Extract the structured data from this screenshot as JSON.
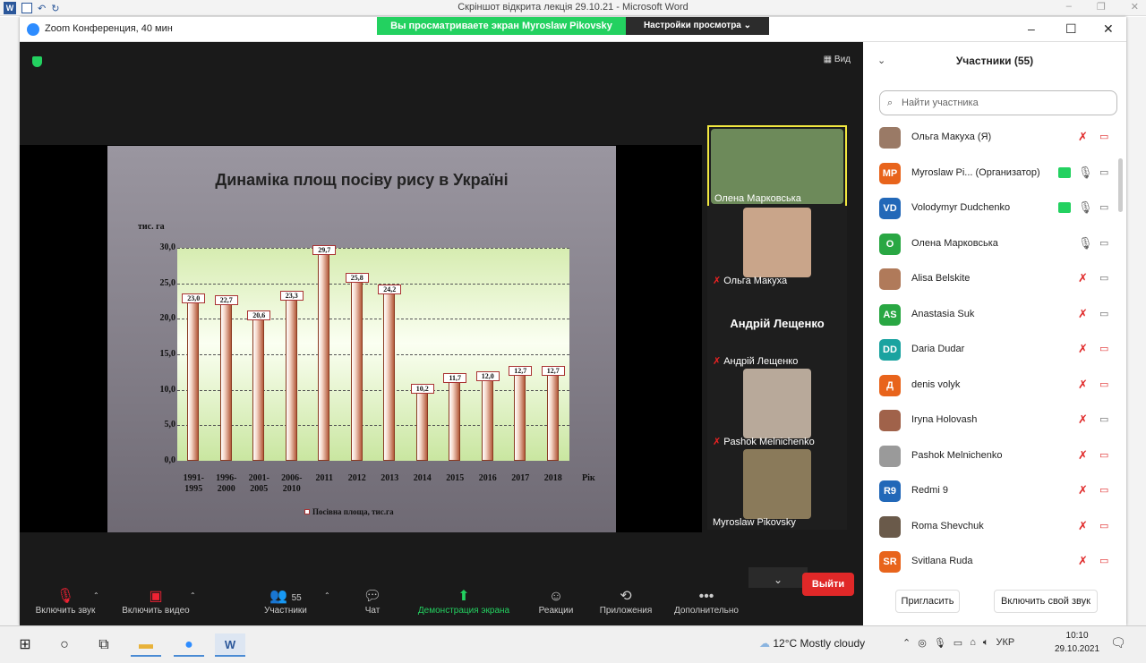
{
  "word": {
    "title": "Скріншот відкрита лекція 29.10.21 - Microsoft Word"
  },
  "zoom": {
    "title": "Zoom Конференция, 40 мин",
    "share_banner": "Вы просматриваете экран Myroslaw Pikovsky",
    "view_settings": "Настройки просмотра ⌄",
    "view_button": "Вид"
  },
  "slide": {
    "title": "Динаміка площ посіву рису в Україні",
    "legend": "Посівна площа, тис.га"
  },
  "chart_data": {
    "type": "bar",
    "title": "Динаміка площ посіву рису в Україні",
    "ylabel": "тис. га",
    "xlabel": "Рік",
    "ylim": [
      0,
      30
    ],
    "yticks": [
      "0,0",
      "5,0",
      "10,0",
      "15,0",
      "20,0",
      "25,0",
      "30,0"
    ],
    "categories": [
      "1991-1995",
      "1996-2000",
      "2001-2005",
      "2006-2010",
      "2011",
      "2012",
      "2013",
      "2014",
      "2015",
      "2016",
      "2017",
      "2018"
    ],
    "category_lines": [
      [
        "1991-",
        "1995"
      ],
      [
        "1996-",
        "2000"
      ],
      [
        "2001-",
        "2005"
      ],
      [
        "2006-",
        "2010"
      ],
      [
        "2011"
      ],
      [
        "2012"
      ],
      [
        "2013"
      ],
      [
        "2014"
      ],
      [
        "2015"
      ],
      [
        "2016"
      ],
      [
        "2017"
      ],
      [
        "2018"
      ]
    ],
    "values": [
      23.0,
      22.7,
      20.6,
      23.3,
      29.7,
      25.8,
      24.2,
      10.2,
      11.7,
      12.0,
      12.7,
      12.7
    ],
    "value_labels": [
      "23,0",
      "22,7",
      "20,6",
      "23,3",
      "29,7",
      "25,8",
      "24,2",
      "10,2",
      "11,7",
      "12,0",
      "12,7",
      "12,7"
    ],
    "series": [
      {
        "name": "Посівна площа, тис.га"
      }
    ],
    "grid": true,
    "legend": "bottom"
  },
  "thumbnails": [
    {
      "name": "Олена Марковська",
      "muted": false,
      "active": true,
      "bg": "#6d8a5a"
    },
    {
      "name": "Ольга Макуха",
      "muted": true,
      "active": false,
      "bg": "#c9a58a"
    },
    {
      "name": "Андрій Лещенко",
      "muted": true,
      "active": false,
      "big": "Андрій Лещенко"
    },
    {
      "name": "Pashok Melnichenko",
      "muted": true,
      "active": false,
      "bg": "#b8a99a"
    },
    {
      "name": "Myroslaw Pikovsky",
      "muted": false,
      "active": false,
      "bg": "#8a7a5a"
    }
  ],
  "toolbar": {
    "audio": "Включить звук",
    "video": "Включить видео",
    "participants": "Участники",
    "participants_count": "55",
    "chat": "Чат",
    "share": "Демонстрация экрана",
    "reactions": "Реакции",
    "apps": "Приложения",
    "more": "Дополнительно",
    "leave": "Выйти"
  },
  "panel": {
    "title": "Участники (55)",
    "search_placeholder": "Найти участника",
    "invite": "Пригласить",
    "unmute_self": "Включить свой звук",
    "participants": [
      {
        "name": "Ольга Макуха (Я)",
        "initials": "",
        "color": "#9a7a66",
        "mic_muted": true,
        "cam_off": true,
        "sharing": false
      },
      {
        "name": "Myroslaw Pi... (Организатор)",
        "initials": "MP",
        "color": "#e8641c",
        "mic_muted": false,
        "cam_off": false,
        "sharing": true
      },
      {
        "name": "Volodymyr Dudchenko",
        "initials": "VD",
        "color": "#2268b8",
        "mic_muted": false,
        "cam_off": false,
        "sharing": true
      },
      {
        "name": "Олена Марковська",
        "initials": "О",
        "color": "#29a743",
        "mic_muted": false,
        "cam_off": false,
        "sharing": false
      },
      {
        "name": "Alisa Belskite",
        "initials": "",
        "color": "#b07a5a",
        "mic_muted": true,
        "cam_off": false,
        "sharing": false
      },
      {
        "name": "Anastasia Suk",
        "initials": "AS",
        "color": "#29a743",
        "mic_muted": true,
        "cam_off": false,
        "sharing": false
      },
      {
        "name": "Daria Dudar",
        "initials": "DD",
        "color": "#1aa3a0",
        "mic_muted": true,
        "cam_off": true,
        "sharing": false
      },
      {
        "name": "denis volyk",
        "initials": "Д",
        "color": "#e8641c",
        "mic_muted": true,
        "cam_off": true,
        "sharing": false
      },
      {
        "name": "Iryna Holovash",
        "initials": "",
        "color": "#a0624a",
        "mic_muted": true,
        "cam_off": false,
        "sharing": false
      },
      {
        "name": "Pashok Melnichenko",
        "initials": "",
        "color": "#9a9a9a",
        "mic_muted": true,
        "cam_off": true,
        "sharing": false
      },
      {
        "name": "Redmi 9",
        "initials": "R9",
        "color": "#2268b8",
        "mic_muted": true,
        "cam_off": true,
        "sharing": false
      },
      {
        "name": "Roma Shevchuk",
        "initials": "",
        "color": "#6a5a4a",
        "mic_muted": true,
        "cam_off": true,
        "sharing": false
      },
      {
        "name": "Svitlana Ruda",
        "initials": "SR",
        "color": "#e8641c",
        "mic_muted": true,
        "cam_off": true,
        "sharing": false
      }
    ]
  },
  "taskbar": {
    "weather": "12°C  Mostly cloudy",
    "lang": "УКР",
    "time": "10:10",
    "date": "29.10.2021"
  },
  "colors": {
    "zoom_green": "#23d160",
    "leave_red": "#e02828",
    "bar": "#d9a48c"
  }
}
